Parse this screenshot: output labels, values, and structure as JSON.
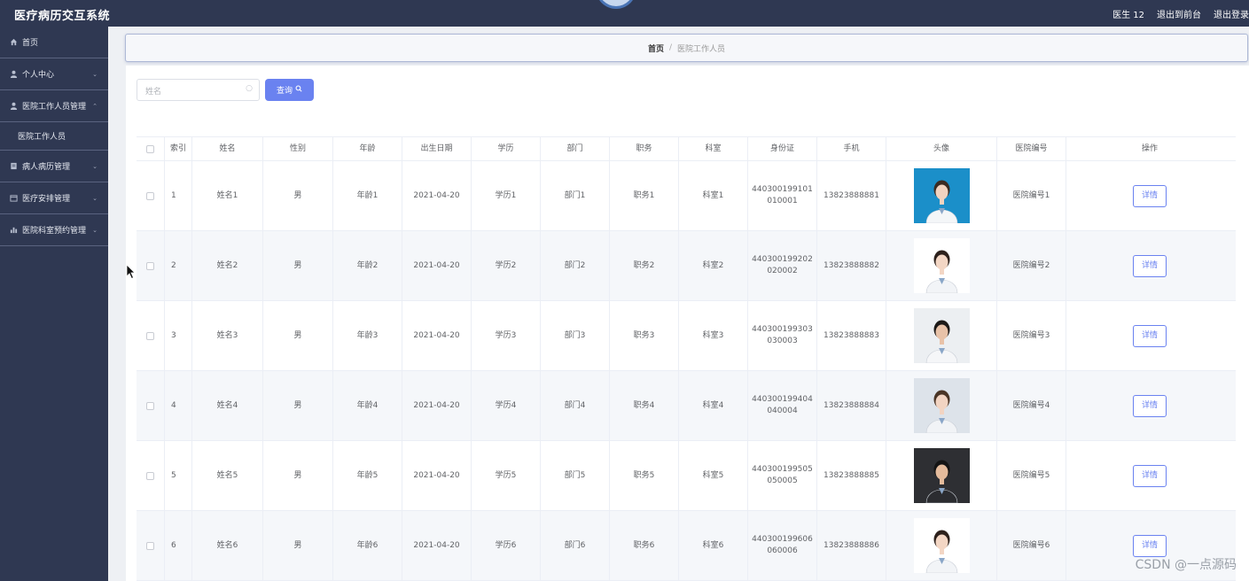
{
  "app": {
    "title": "医疗病历交互系统"
  },
  "header": {
    "user": "医生 12",
    "to_front": "退出到前台",
    "logout": "退出登录"
  },
  "sidebar": {
    "items": [
      {
        "label": "首页",
        "icon": "home-icon"
      },
      {
        "label": "个人中心",
        "icon": "user-icon"
      },
      {
        "label": "医院工作人员管理",
        "icon": "user-icon"
      },
      {
        "label": "医院工作人员",
        "icon": ""
      },
      {
        "label": "病人病历管理",
        "icon": "document-icon"
      },
      {
        "label": "医疗安排管理",
        "icon": "calendar-icon"
      },
      {
        "label": "医院科室预约管理",
        "icon": "chart-icon"
      }
    ]
  },
  "breadcrumb": {
    "home": "首页",
    "separator": "/",
    "current": "医院工作人员"
  },
  "search": {
    "placeholder": "姓名",
    "button": "查询"
  },
  "table": {
    "headers": [
      "",
      "索引",
      "姓名",
      "性别",
      "年龄",
      "出生日期",
      "学历",
      "部门",
      "职务",
      "科室",
      "身份证",
      "手机",
      "头像",
      "医院编号",
      "操作"
    ],
    "rows": [
      {
        "index": "1",
        "name": "姓名1",
        "gender": "男",
        "age": "年龄1",
        "birth": "2021-04-20",
        "edu": "学历1",
        "dept": "部门1",
        "job": "职务1",
        "section": "科室1",
        "id_a": "440300199101",
        "id_b": "010001",
        "phone": "13823888881",
        "hospital_no": "医院编号1",
        "action": "详情"
      },
      {
        "index": "2",
        "name": "姓名2",
        "gender": "男",
        "age": "年龄2",
        "birth": "2021-04-20",
        "edu": "学历2",
        "dept": "部门2",
        "job": "职务2",
        "section": "科室2",
        "id_a": "440300199202",
        "id_b": "020002",
        "phone": "13823888882",
        "hospital_no": "医院编号2",
        "action": "详情"
      },
      {
        "index": "3",
        "name": "姓名3",
        "gender": "男",
        "age": "年龄3",
        "birth": "2021-04-20",
        "edu": "学历3",
        "dept": "部门3",
        "job": "职务3",
        "section": "科室3",
        "id_a": "440300199303",
        "id_b": "030003",
        "phone": "13823888883",
        "hospital_no": "医院编号3",
        "action": "详情"
      },
      {
        "index": "4",
        "name": "姓名4",
        "gender": "男",
        "age": "年龄4",
        "birth": "2021-04-20",
        "edu": "学历4",
        "dept": "部门4",
        "job": "职务4",
        "section": "科室4",
        "id_a": "440300199404",
        "id_b": "040004",
        "phone": "13823888884",
        "hospital_no": "医院编号4",
        "action": "详情"
      },
      {
        "index": "5",
        "name": "姓名5",
        "gender": "男",
        "age": "年龄5",
        "birth": "2021-04-20",
        "edu": "学历5",
        "dept": "部门5",
        "job": "职务5",
        "section": "科室5",
        "id_a": "440300199505",
        "id_b": "050005",
        "phone": "13823888885",
        "hospital_no": "医院编号5",
        "action": "详情"
      },
      {
        "index": "6",
        "name": "姓名6",
        "gender": "男",
        "age": "年龄6",
        "birth": "2021-04-20",
        "edu": "学历6",
        "dept": "部门6",
        "job": "职务6",
        "section": "科室6",
        "id_a": "440300199606",
        "id_b": "060006",
        "phone": "13823888886",
        "hospital_no": "医院编号6",
        "action": "详情"
      }
    ]
  },
  "watermark": "CSDN @一点源码",
  "colors": {
    "sidebar": "#2f3852",
    "accent": "#6a82f0"
  }
}
